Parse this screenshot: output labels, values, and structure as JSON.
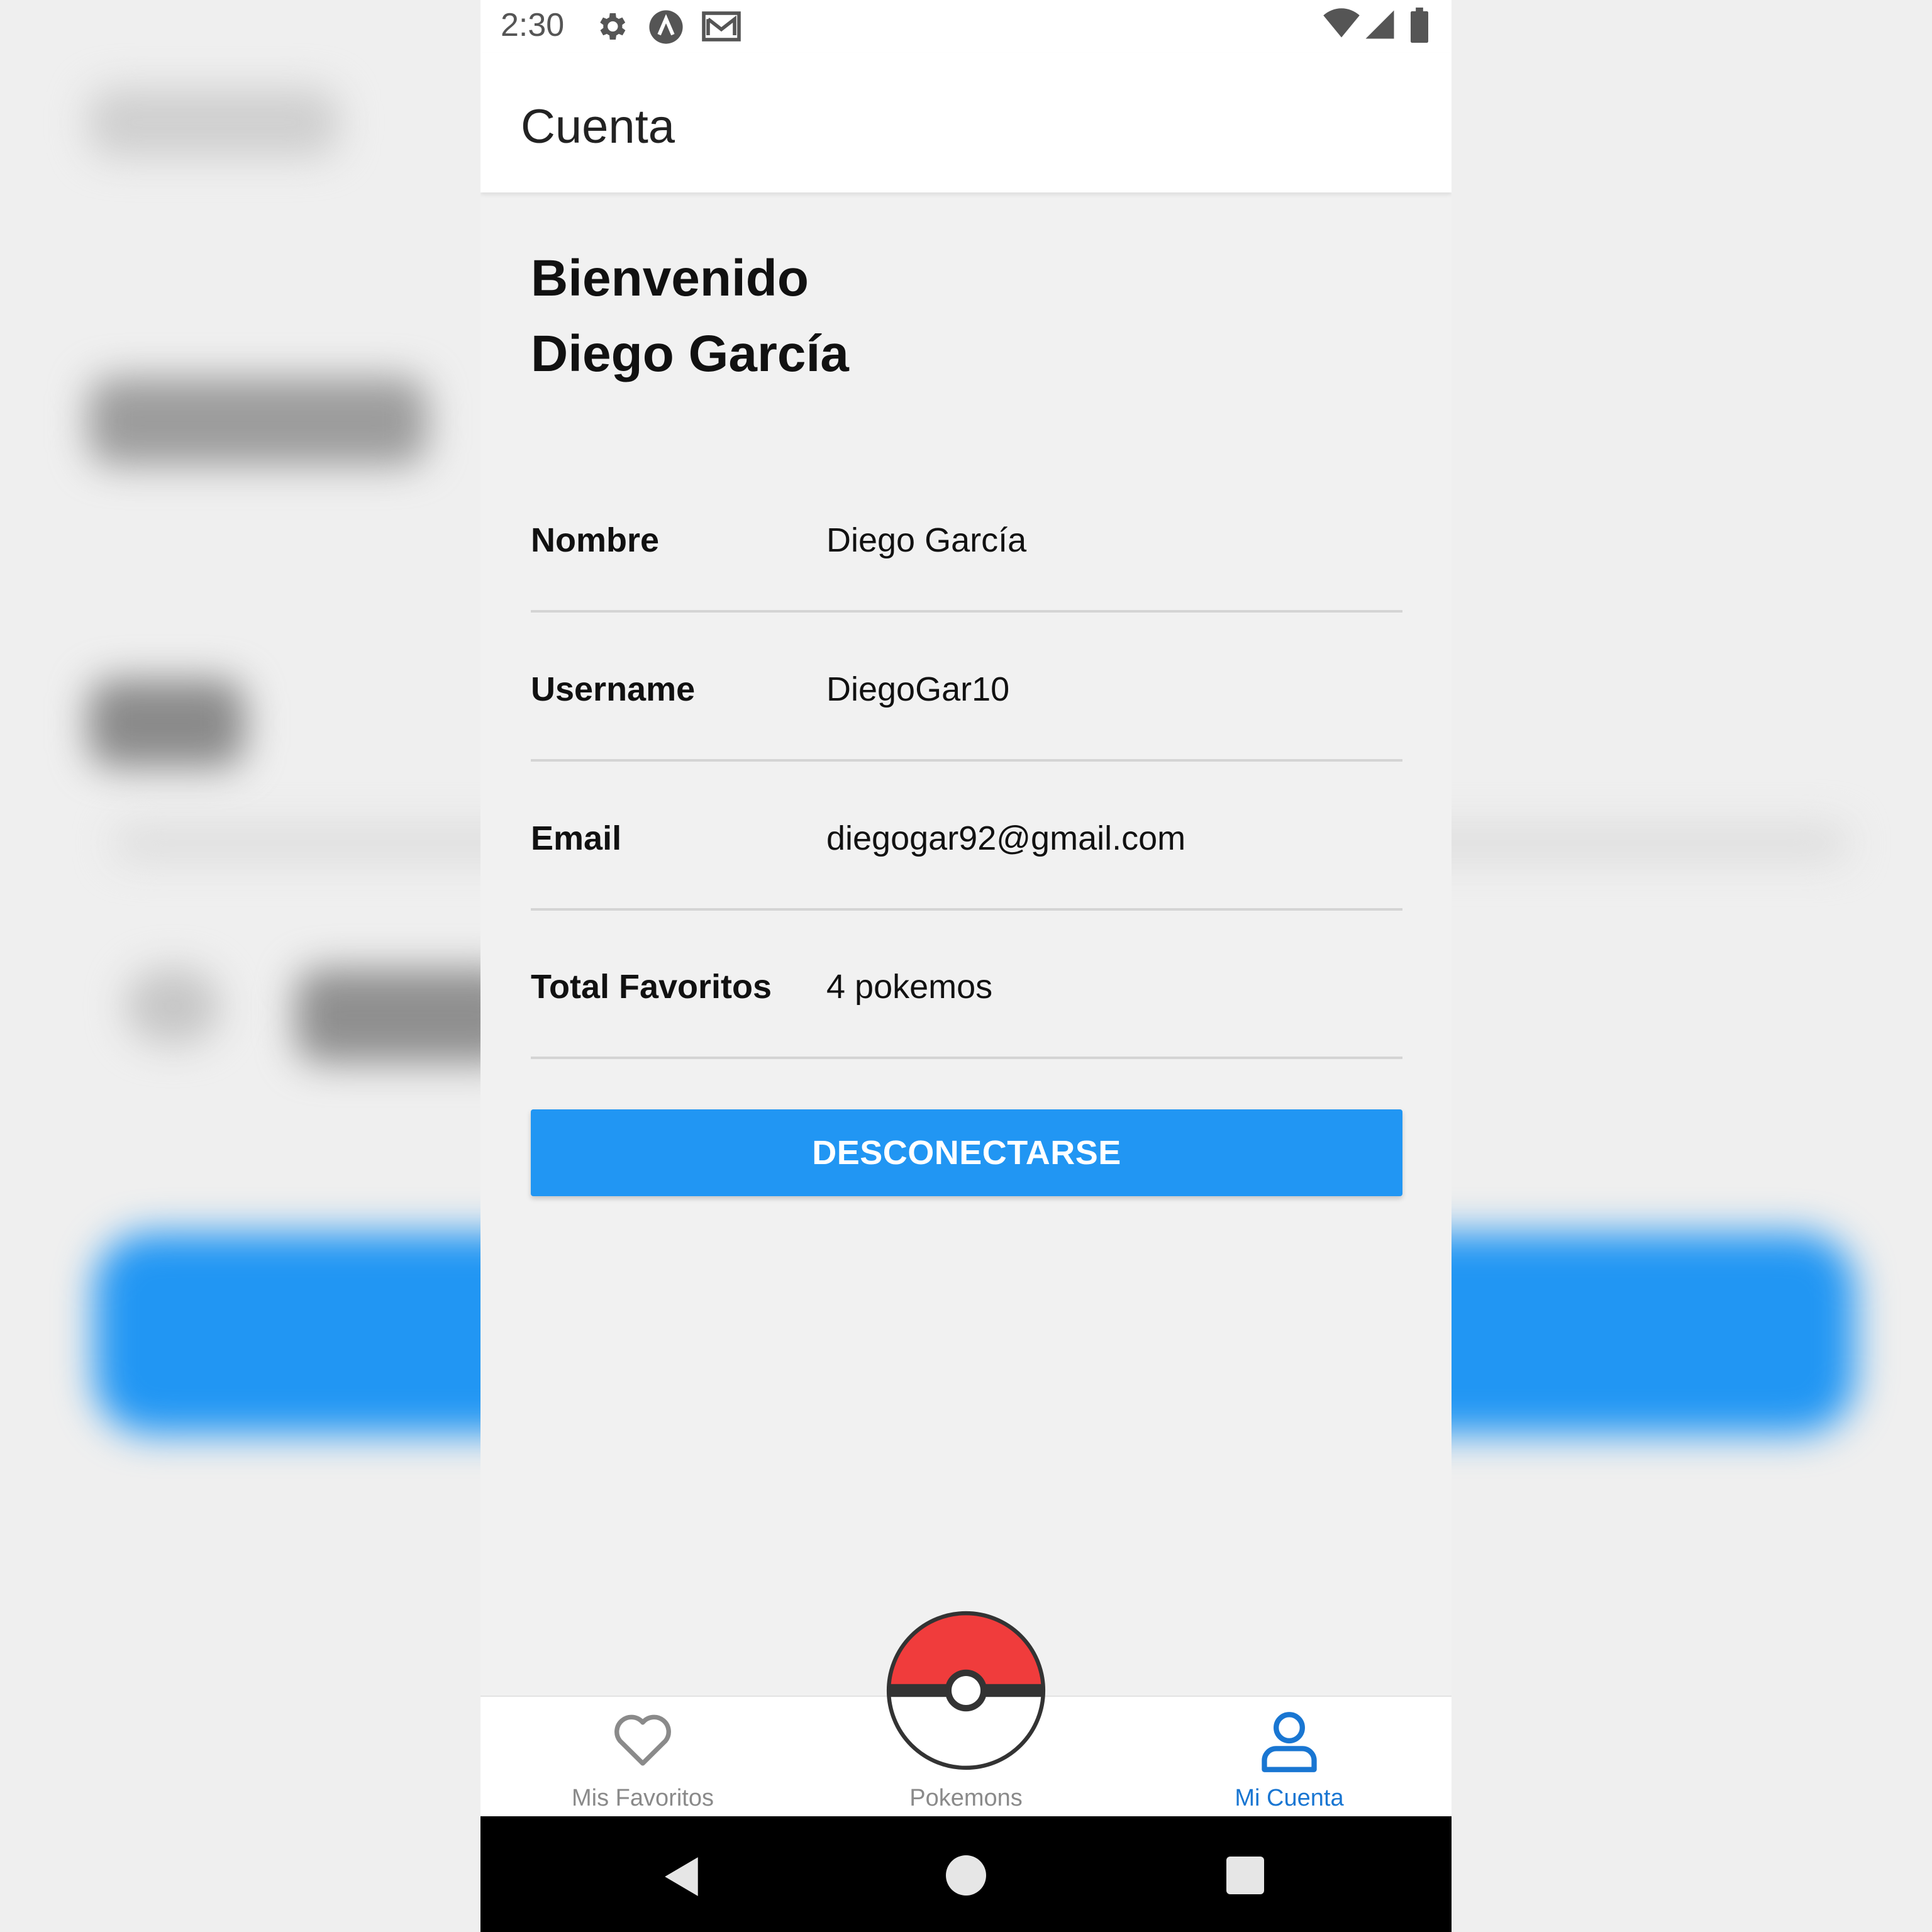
{
  "status_bar": {
    "time": "2:30",
    "left_icons": [
      "settings-icon",
      "app-icon",
      "mail-icon"
    ],
    "right_icons": [
      "wifi-icon",
      "signal-icon",
      "battery-icon"
    ]
  },
  "app_bar": {
    "title": "Cuenta"
  },
  "welcome": {
    "line1": "Bienvenido",
    "line2": "Diego García"
  },
  "account_rows": [
    {
      "label": "Nombre",
      "value": "Diego García"
    },
    {
      "label": "Username",
      "value": "DiegoGar10"
    },
    {
      "label": "Email",
      "value": "diegogar92@gmail.com"
    },
    {
      "label": "Total Favoritos",
      "value": "4 pokemos"
    }
  ],
  "logout_button": {
    "label": "DESCONECTARSE"
  },
  "tab_bar": {
    "tabs": [
      {
        "label": "Mis Favoritos",
        "icon": "heart-icon",
        "active": false
      },
      {
        "label": "Pokemons",
        "icon": "pokeball-icon",
        "active": false
      },
      {
        "label": "Mi Cuenta",
        "icon": "user-icon",
        "active": true
      }
    ],
    "active_color": "#1976d2",
    "inactive_color": "#8a8a8a"
  },
  "nav_bar": {
    "buttons": [
      "back-icon",
      "home-icon",
      "recents-icon"
    ]
  },
  "colors": {
    "primary": "#2196f3",
    "pokeball_red": "#f03c3c"
  }
}
